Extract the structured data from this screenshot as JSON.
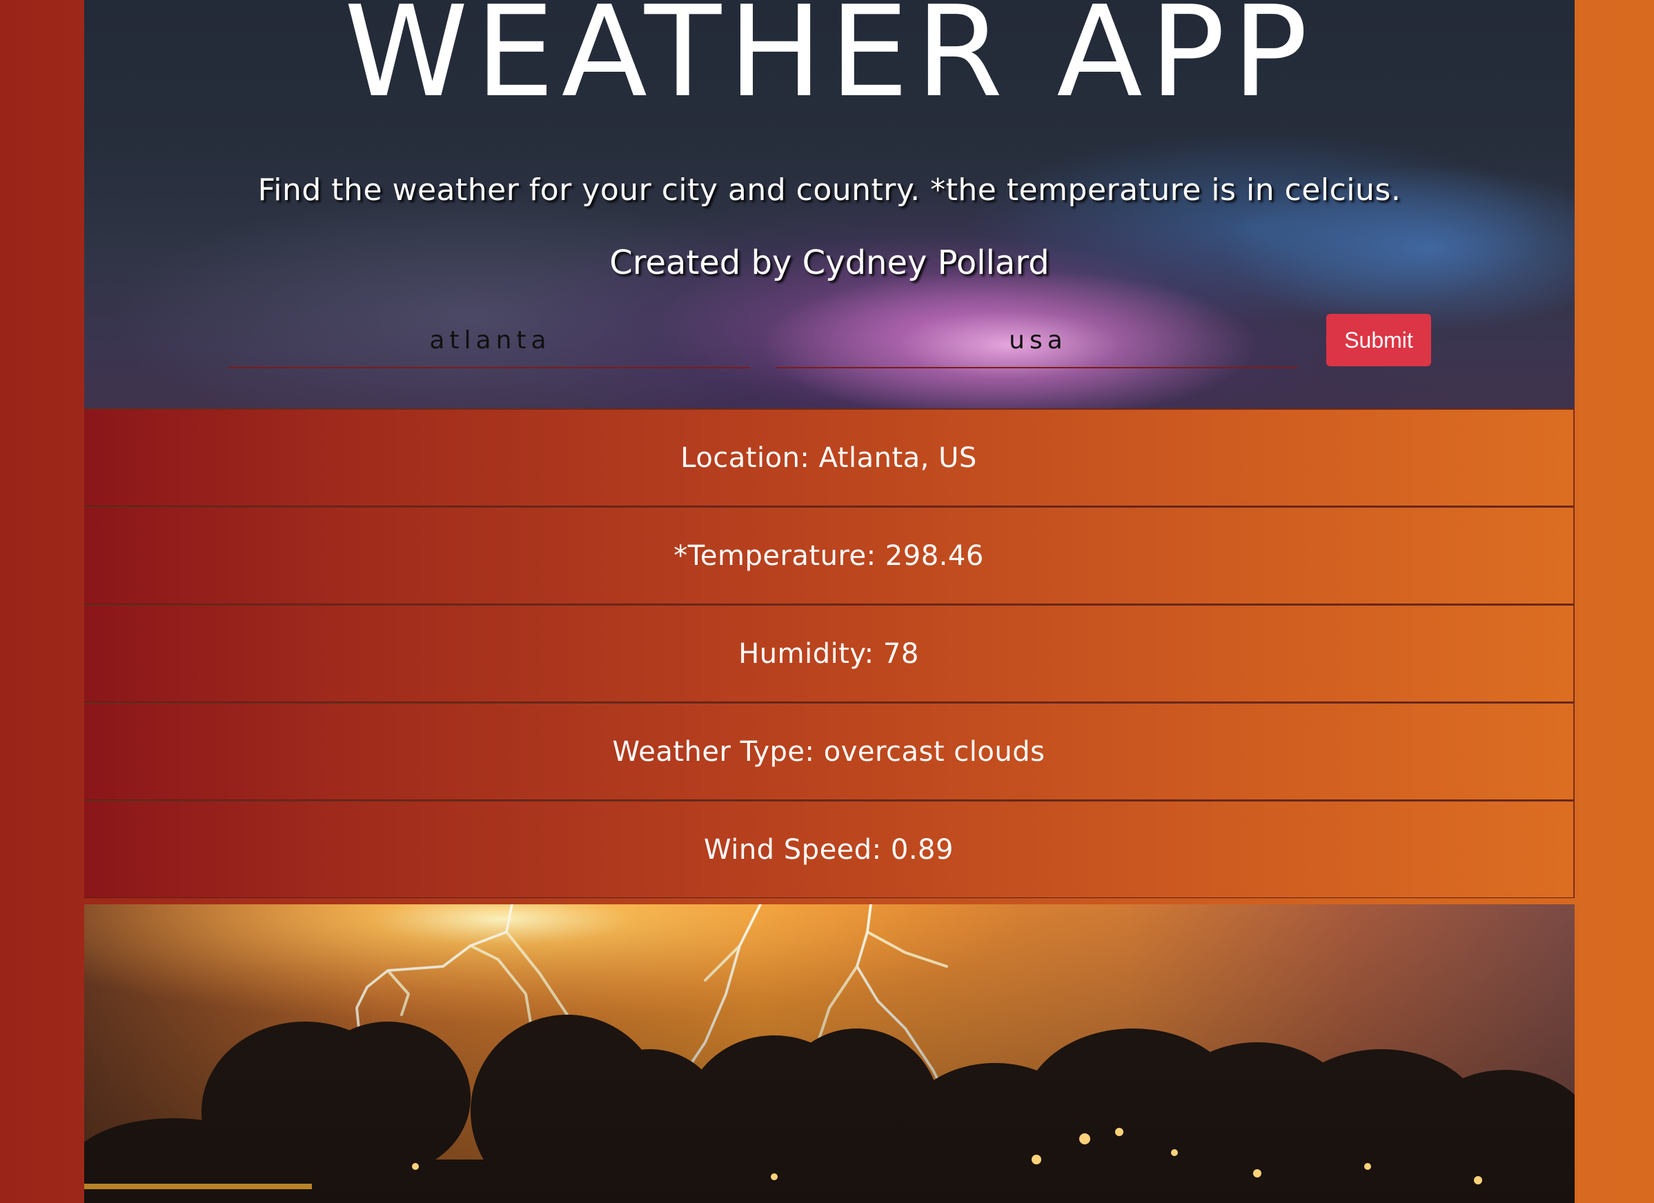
{
  "header": {
    "title": "WEATHER APP",
    "subtitle": "Find the weather for your city and country. *the temperature is in celcius.",
    "credit": "Created by Cydney Pollard"
  },
  "form": {
    "city_value": "atlanta",
    "country_value": "usa",
    "submit_label": "Submit"
  },
  "results": {
    "location": "Location: Atlanta, US",
    "temperature": "*Temperature: 298.46",
    "humidity": "Humidity: 78",
    "weather_type": "Weather Type: overcast clouds",
    "wind_speed": "Wind Speed: 0.89"
  },
  "colors": {
    "submit_button": "#dc3545",
    "gradient_left": "#8b161a",
    "gradient_right": "#dc6e22",
    "sky": "#232a38"
  }
}
